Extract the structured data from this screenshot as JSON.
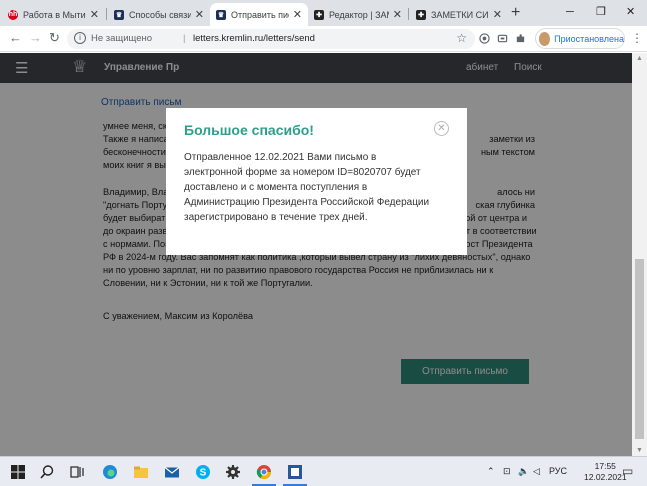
{
  "tabs": [
    {
      "title": "Работа в Мытищ",
      "favicon": "hh-icon",
      "color": "#d6001c",
      "glyph": "hh"
    },
    {
      "title": "Способы связи с",
      "favicon": "kremlin-icon",
      "color": "#1c2f5a",
      "glyph": "♛"
    },
    {
      "title": "Отправить письм",
      "favicon": "kremlin-icon",
      "color": "#1c2f5a",
      "glyph": "♛"
    },
    {
      "title": "Редактор | ЗАМЕ",
      "favicon": "editor-icon",
      "color": "#222222",
      "glyph": "✚"
    },
    {
      "title": "ЗАМЕТКИ СИСТЕ",
      "favicon": "editor-icon",
      "color": "#222222",
      "glyph": "✚"
    }
  ],
  "toolbar": {
    "security": "Не защищено",
    "separator": "|",
    "url": "letters.kremlin.ru/letters/send",
    "profile_label": "Приостановлена"
  },
  "site": {
    "name": "Управление Пр",
    "cabinet": "абинет",
    "search": "Поиск",
    "breadcrumb": "Отправить письм"
  },
  "letter": {
    "head_lines": [
      {
        "left": "умнее меня, ско",
        "right": ""
      },
      {
        "left": "Также я написа",
        "right": "заметки из"
      },
      {
        "left": "бесконечности\"",
        "right": "ным текстом"
      },
      {
        "left": "моих книг я выс",
        "right": ""
      }
    ],
    "body_first": {
      "left": "Владимир, Влад",
      "right": "алось ни"
    },
    "body_second": {
      "left": "\"догнать Португ",
      "right": "ская глубинка"
    },
    "body_lines": [
      "будет выбирать и дальше. Я не вижу будущего у России как развитой станы ,в которой от центра и",
      "до окраин развита инфраструктура, действует принцип законности, а асфальт кладут в соответствии",
      "с нормами. Поэтому я считаю, что Вам не следует выдвигать свою кандидатуру на пост Президента",
      "РФ в 2024-м году. Вас запомнят как политика ,который вывел страну из \"лихих девяностых\", однако",
      "ни по уровню зарплат, ни по развитию правового государства Россия не приблизилась ни к",
      "Словении, ни к Эстонии, ни к той же Португалии."
    ],
    "signature": "С уважением, Максим из Королёва"
  },
  "send_button": "Отправить письмо",
  "modal": {
    "title": "Большое спасибо!",
    "lines": [
      "Отправленное 12.02.2021 Вами письмо в",
      "электронной форме за номером ID=8020707 будет",
      "доставлено и с момента поступления в",
      "Администрацию Президента Российской Федерации",
      "зарегистрировано в течение трех дней."
    ]
  },
  "taskbar": {
    "lang": "РУС",
    "time": "17:55",
    "date": "12.02.2021"
  },
  "colors": {
    "accent_green": "#2e9e8a",
    "button_green": "#2e8b7a",
    "site_header": "#44474e"
  }
}
